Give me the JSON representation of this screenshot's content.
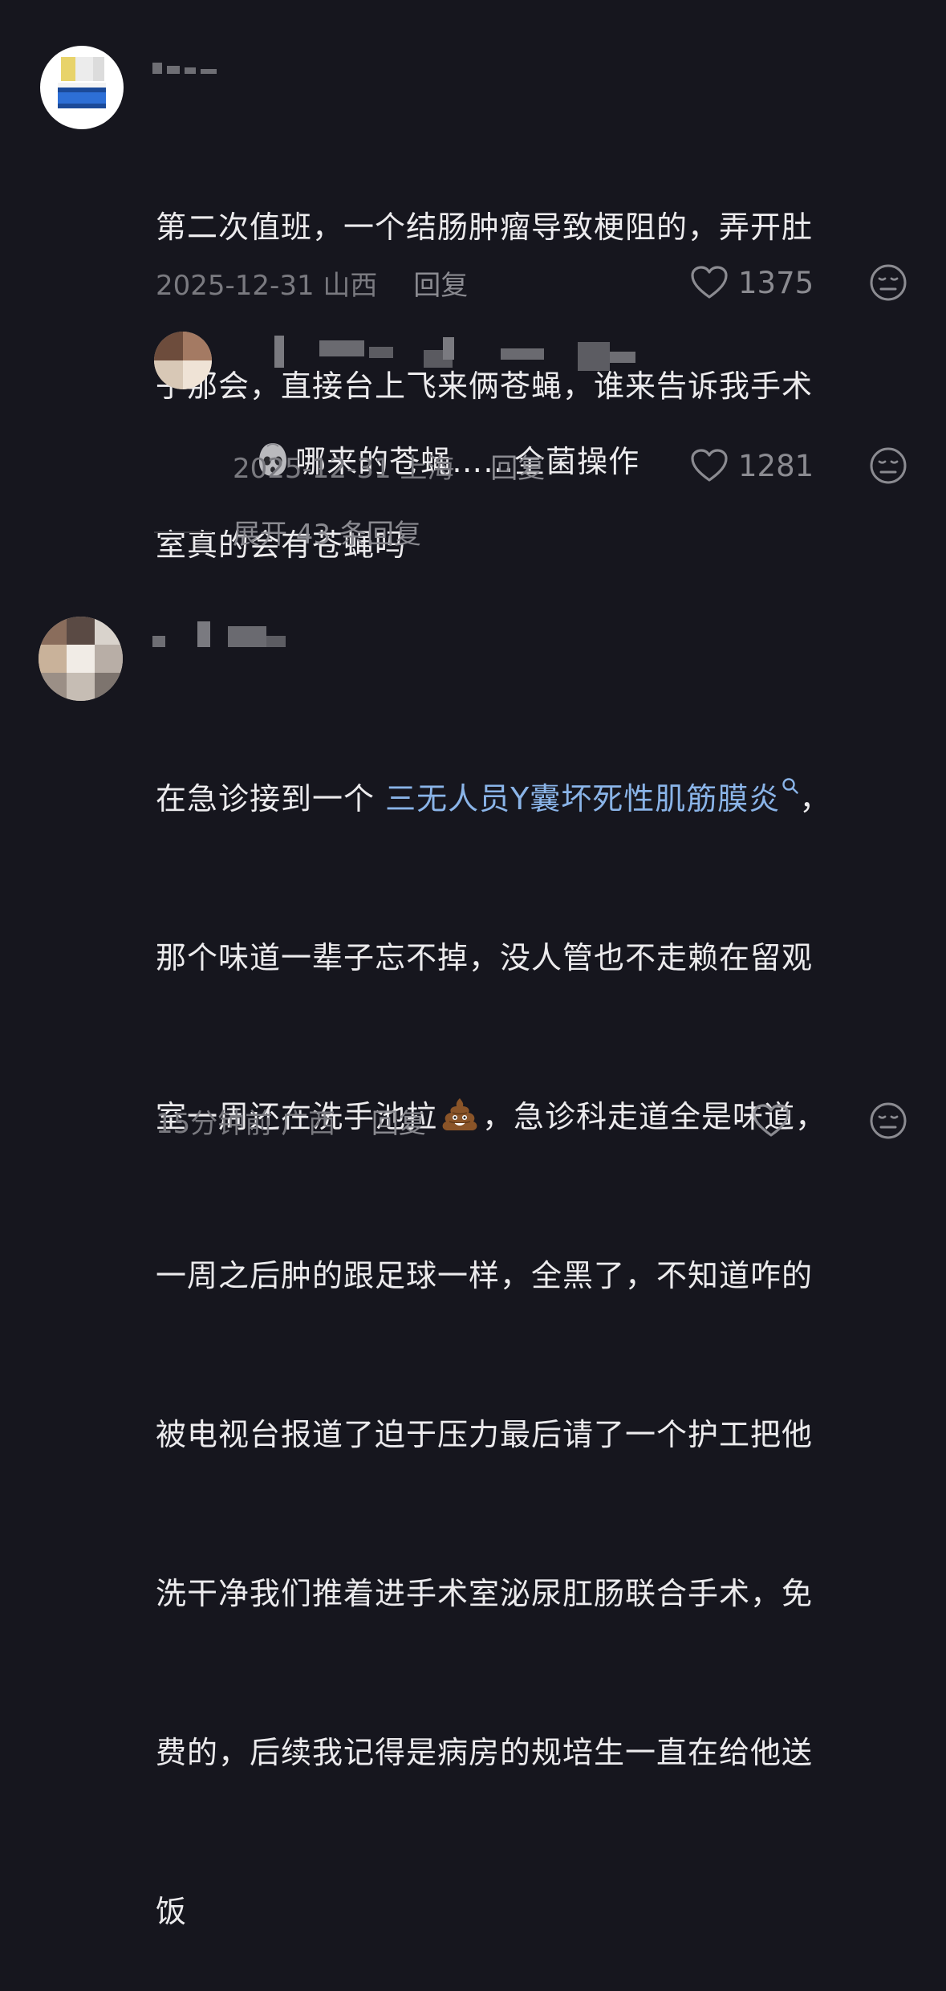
{
  "colors": {
    "background": "#16161e",
    "text": "#ecebed",
    "meta": "#7a7a80",
    "link": "#8ab4e8"
  },
  "comments": [
    {
      "text_lines": [
        "第二次值班，一个结肠肿瘤导致梗阻的，弄开肚",
        "子那会，直接台上飞来俩苍蝇，谁来告诉我手术",
        "室真的会有苍蝇吗"
      ],
      "date": "2025-12-31",
      "location": "山西",
      "reply_label": "回复",
      "likes": "1375",
      "like_icon": "heart-outline-icon",
      "react_icon": "neutral-face-icon"
    },
    {
      "is_reply": true,
      "emoji": "pensive-ghost-emoji",
      "text": "哪来的苍蝇……全菌操作",
      "date": "2025-12-31",
      "location": "上海",
      "reply_label": "回复",
      "likes": "1281",
      "like_icon": "heart-outline-icon",
      "react_icon": "neutral-face-icon"
    },
    {
      "text_prefix": "在急诊接到一个 ",
      "link_text": "三无人员Y囊坏死性肌筋膜炎",
      "search_icon": "search-icon",
      "text_after_link": "，",
      "text_lines": [
        "那个味道一辈子忘不掉，没人管也不走赖在留观",
        "室一周还在洗手池拉",
        "，急诊科走道全是味道，",
        "一周之后肿的跟足球一样，全黑了，不知道咋的",
        "被电视台报道了迫于压力最后请了一个护工把他",
        "洗干净我们推着进手术室泌尿肛肠联合手术，免",
        "费的，后续我记得是病房的规培生一直在给他送",
        "饭"
      ],
      "inline_emoji": "pile-of-poo-emoji",
      "date": "15分钟前",
      "location": "广西",
      "reply_label": "回复",
      "like_icon": "heart-outline-icon",
      "react_icon": "neutral-face-icon"
    }
  ],
  "expand_replies": "展开 43 条回复"
}
